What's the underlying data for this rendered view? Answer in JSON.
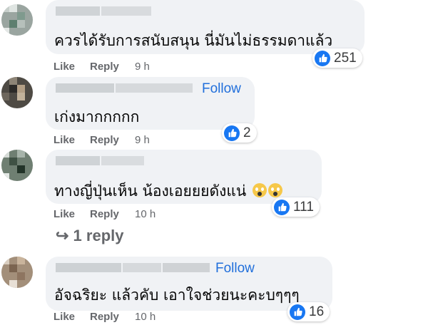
{
  "colors": {
    "accent": "#216fdb",
    "bubble": "#f0f2f5",
    "meta_text": "#65676b",
    "like_blue": "#1877f2"
  },
  "comments": [
    {
      "text": "ควรได้รับการสนับสนุน นี่มันไม่ธรรมดาแล้ว",
      "follow": "",
      "reaction_icon": "like-icon",
      "reactions": "251",
      "like": "Like",
      "reply": "Reply",
      "time": "9 h"
    },
    {
      "text": "เก่งมากกกกก",
      "follow": "Follow",
      "reaction_icon": "like-icon",
      "reactions": "2",
      "like": "Like",
      "reply": "Reply",
      "time": "9 h"
    },
    {
      "text": "ทางญี่ปุ่นเห็น น้องเอยยยดังแน่",
      "follow": "",
      "reaction_icon": "like-icon",
      "reactions": "111",
      "like": "Like",
      "reply": "Reply",
      "time": "10 h",
      "emoji_icon": "screaming-face-emoji"
    },
    {
      "text": "อัจฉริยะ แล้วคับ เอาใจช่วยนะคะบๆๆๆ",
      "follow": "Follow",
      "reaction_icon": "like-icon",
      "reactions": "16",
      "like": "Like",
      "reply": "Reply",
      "time": "10 h"
    }
  ],
  "replies_link": "↪ 1 reply"
}
